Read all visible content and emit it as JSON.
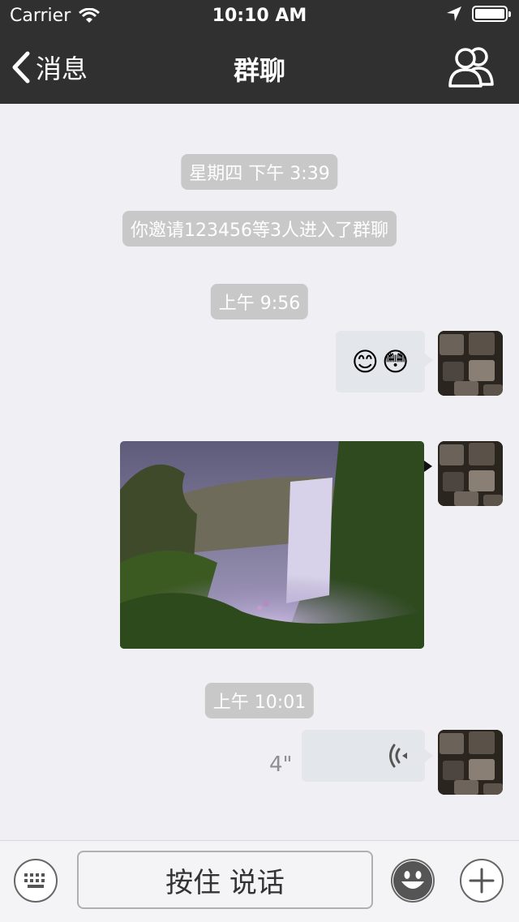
{
  "status_bar": {
    "carrier": "Carrier",
    "time": "10:10 AM"
  },
  "nav": {
    "back_label": "消息",
    "title": "群聊"
  },
  "messages": {
    "time1": "星期四 下午 3:39",
    "system": "你邀请123456等3人进入了群聊",
    "time2": "上午 9:56",
    "emoji_msg": [
      "😊",
      "😳"
    ],
    "time3": "上午 10:01",
    "voice_duration": "4\""
  },
  "toolbar": {
    "hold_to_talk": "按住 说话"
  },
  "colors": {
    "bar_bg": "#303030",
    "chat_bg": "#efeff4",
    "bubble": "#e3e6ea",
    "time_pill": "#c8c8c8"
  }
}
